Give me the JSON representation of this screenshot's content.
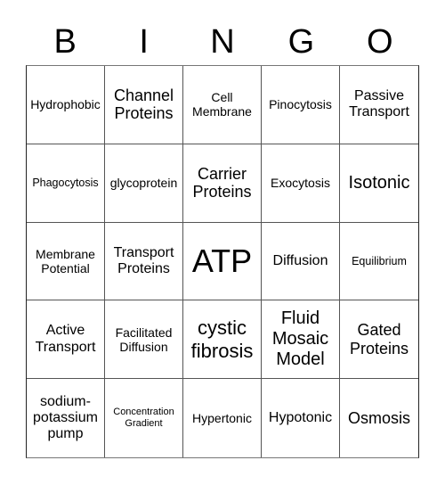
{
  "header": {
    "letters": [
      "B",
      "I",
      "N",
      "G",
      "O"
    ]
  },
  "board": {
    "cells": [
      "Hydrophobic",
      "Channel\nProteins",
      "Cell\nMembrane",
      "Pinocytosis",
      "Passive\nTransport",
      "Phagocytosis",
      "glycoprotein",
      "Carrier\nProteins",
      "Exocytosis",
      "Isotonic",
      "Membrane\nPotential",
      "Transport\nProteins",
      "ATP",
      "Diffusion",
      "Equilibrium",
      "Active\nTransport",
      "Facilitated\nDiffusion",
      "cystic\nfibrosis",
      "Fluid\nMosaic\nModel",
      "Gated\nProteins",
      "sodium-\npotassium\npump",
      "Concentration\nGradient",
      "Hypertonic",
      "Hypotonic",
      "Osmosis"
    ]
  }
}
